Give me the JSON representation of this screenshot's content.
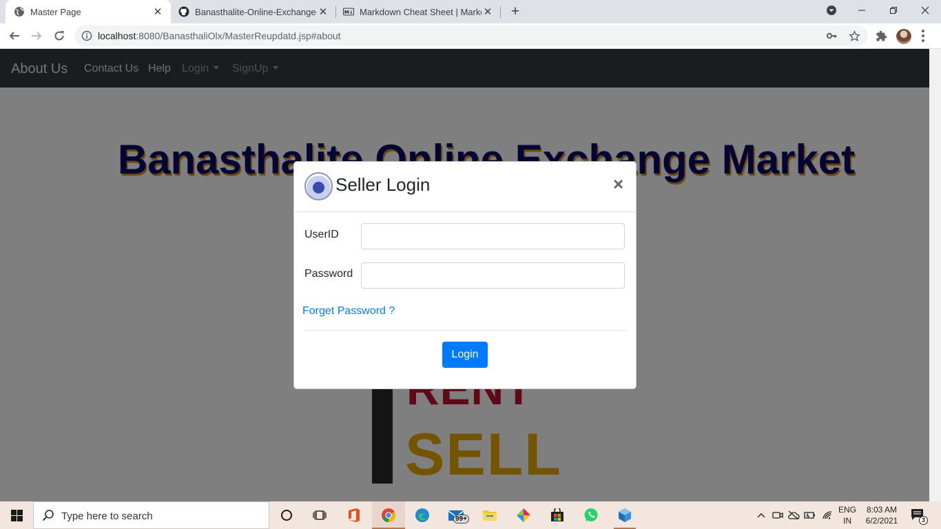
{
  "browser": {
    "tabs": [
      {
        "title": "Master Page",
        "icon": "globe-icon",
        "active": true
      },
      {
        "title": "Banasthalite-Online-Exchange-M",
        "icon": "github-icon",
        "active": false
      },
      {
        "title": "Markdown Cheat Sheet | Markdo",
        "icon": "markdown-icon",
        "active": false
      }
    ],
    "new_tab_label": "+",
    "address": {
      "host": "localhost",
      "rest": ":8080/BanasthaliOlx/MasterReupdatd.jsp#about"
    }
  },
  "navbar": {
    "brand": "About Us",
    "links": [
      "Contact Us",
      "Help"
    ],
    "dropdowns": [
      "Login",
      "SignUp"
    ]
  },
  "hero": {
    "title": "Banasthalite Online Exchange Market",
    "graphic_words": [
      "RENT",
      "SELL"
    ]
  },
  "modal": {
    "title": "Seller Login",
    "close_label": "×",
    "fields": [
      {
        "label": "UserID",
        "value": "",
        "placeholder": ""
      },
      {
        "label": "Password",
        "value": "",
        "placeholder": ""
      }
    ],
    "forgot_link": "Forget Password ?",
    "submit_label": "Login"
  },
  "taskbar": {
    "search_placeholder": "Type here to search",
    "mail_badge": "99+",
    "language": {
      "line1": "ENG",
      "line2": "IN"
    },
    "clock": {
      "time": "8:03 AM",
      "date": "6/2/2021"
    },
    "notification_count": "3"
  },
  "colors": {
    "navbar": "#343a40",
    "primary": "#007bff",
    "hero_title": "#0b0b66",
    "hero_shadow": "#d08a1c",
    "taskbar": "#f3e6df"
  }
}
